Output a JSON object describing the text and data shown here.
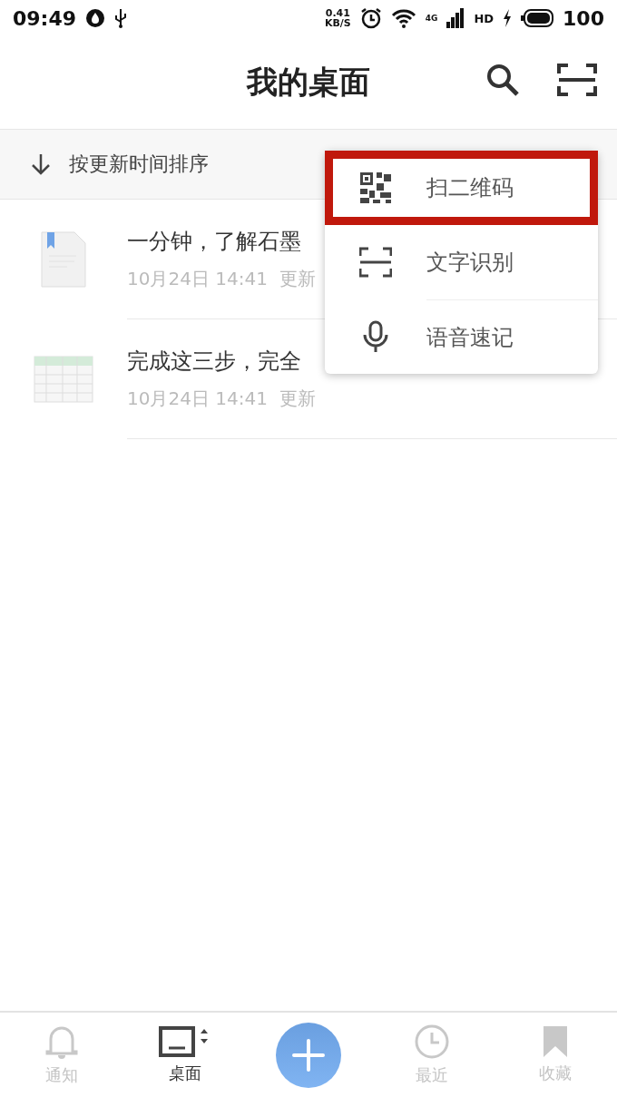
{
  "status_bar": {
    "time": "09:49",
    "net_speed": "0.41",
    "net_unit": "KB/S",
    "network": "4G",
    "hd": "HD",
    "battery": "100"
  },
  "header": {
    "title": "我的桌面"
  },
  "sort_bar": {
    "label": "按更新时间排序"
  },
  "files": [
    {
      "kind": "doc",
      "title": "一分钟，了解石墨",
      "meta": "10月24日 14:41  更新"
    },
    {
      "kind": "sheet",
      "title": "完成这三步，完全",
      "meta": "10月24日 14:41  更新"
    }
  ],
  "menu": {
    "items": [
      {
        "kind": "qr",
        "label": "扫二维码",
        "highlighted": true
      },
      {
        "kind": "scan",
        "label": "文字识别",
        "highlighted": false
      },
      {
        "kind": "mic",
        "label": "语音速记",
        "highlighted": false
      }
    ]
  },
  "bottom_nav": [
    {
      "kind": "bell",
      "label": "通知",
      "selected": false
    },
    {
      "kind": "desktop",
      "label": "桌面",
      "selected": true
    },
    {
      "kind": "add"
    },
    {
      "kind": "clock",
      "label": "最近",
      "selected": false
    },
    {
      "kind": "bookmark",
      "label": "收藏",
      "selected": false
    }
  ]
}
